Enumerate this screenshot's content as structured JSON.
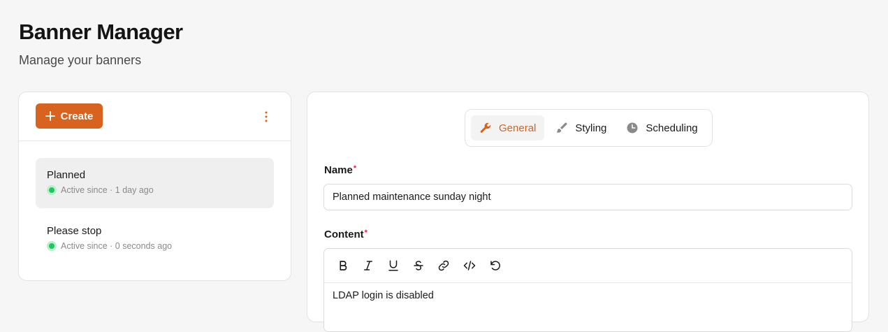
{
  "header": {
    "title": "Banner Manager",
    "subtitle": "Manage your banners"
  },
  "sidebar": {
    "create_label": "Create",
    "banners": [
      {
        "name": "Planned",
        "status": "Active since · 1 day ago",
        "selected": true
      },
      {
        "name": "Please stop",
        "status": "Active since · 0 seconds ago",
        "selected": false
      }
    ]
  },
  "tabs": [
    {
      "label": "General",
      "icon": "wrench-icon",
      "active": true
    },
    {
      "label": "Styling",
      "icon": "brush-icon",
      "active": false
    },
    {
      "label": "Scheduling",
      "icon": "clock-icon",
      "active": false
    }
  ],
  "form": {
    "name_label": "Name",
    "name_value": "Planned maintenance sunday night",
    "content_label": "Content",
    "required_mark": "*",
    "content_value": "LDAP login is disabled",
    "toolbar": [
      "bold-icon",
      "italic-icon",
      "underline-icon",
      "strikethrough-icon",
      "link-icon",
      "code-icon",
      "undo-icon"
    ]
  },
  "colors": {
    "accent": "#d7631f",
    "status_active": "#22c55e",
    "required": "#e11d48"
  }
}
